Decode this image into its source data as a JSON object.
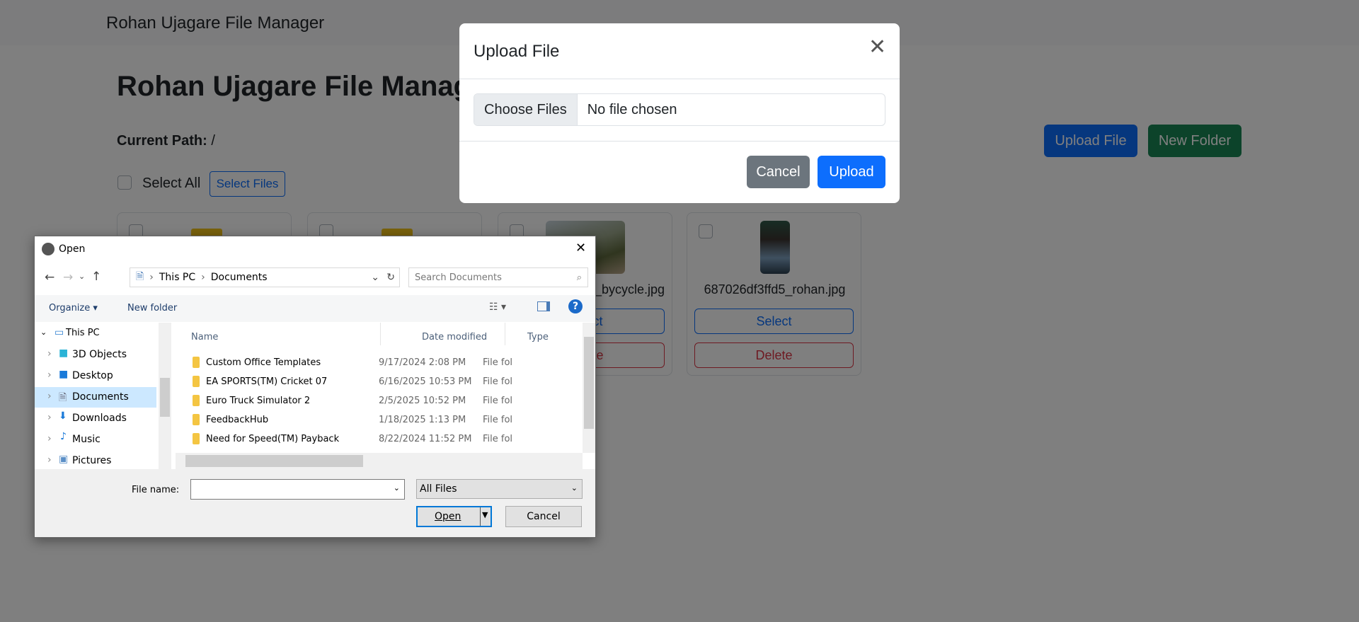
{
  "navbar": {
    "brand": "Rohan Ujagare File Manager"
  },
  "page": {
    "title": "Rohan Ujagare File Manager",
    "current_path_label": "Current Path:",
    "current_path": "/",
    "upload_file": "Upload File",
    "new_folder": "New Folder",
    "select_all": "Select All",
    "select_files": "Select Files"
  },
  "cards": [
    {
      "type": "folder"
    },
    {
      "type": "folder"
    },
    {
      "type": "image",
      "name": "_bycycle.jpg",
      "select": "Select",
      "delete": "Delete"
    },
    {
      "type": "image",
      "name": "687026df3ffd5_rohan.jpg",
      "select": "Select",
      "delete": "Delete"
    }
  ],
  "modal": {
    "title": "Upload File",
    "choose": "Choose Files",
    "no_file": "No file chosen",
    "cancel": "Cancel",
    "upload": "Upload"
  },
  "dialog": {
    "title": "Open",
    "breadcrumb": [
      "This PC",
      "Documents"
    ],
    "search_placeholder": "Search Documents",
    "organize": "Organize",
    "new_folder": "New folder",
    "nav": [
      "This PC",
      "3D Objects",
      "Desktop",
      "Documents",
      "Downloads",
      "Music",
      "Pictures"
    ],
    "columns": [
      "Name",
      "Date modified",
      "Type"
    ],
    "files": [
      {
        "name": "Custom Office Templates",
        "date": "9/17/2024 2:08 PM",
        "type": "File fol"
      },
      {
        "name": "EA SPORTS(TM) Cricket 07",
        "date": "6/16/2025 10:53 PM",
        "type": "File fol"
      },
      {
        "name": "Euro Truck Simulator 2",
        "date": "2/5/2025 10:52 PM",
        "type": "File fol"
      },
      {
        "name": "FeedbackHub",
        "date": "1/18/2025 1:13 PM",
        "type": "File fol"
      },
      {
        "name": "Need for Speed(TM) Payback",
        "date": "8/22/2024 11:52 PM",
        "type": "File fol"
      }
    ],
    "file_name_label": "File name:",
    "file_name_value": "",
    "filter": "All Files",
    "open": "Open",
    "cancel": "Cancel"
  },
  "colors": {
    "primary": "#0d6efd",
    "success": "#198754",
    "danger": "#dc3545",
    "secondary": "#6c757d"
  }
}
